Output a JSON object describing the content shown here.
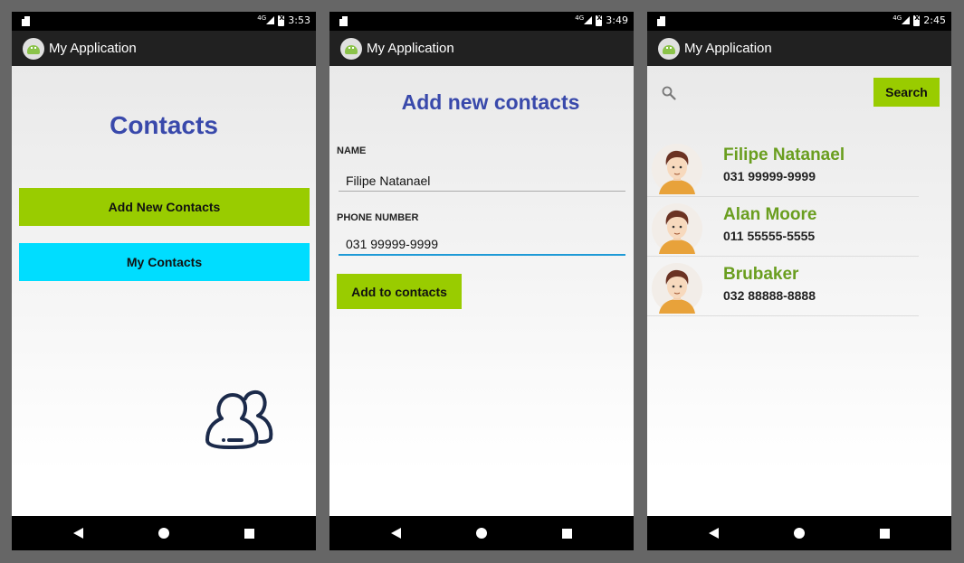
{
  "app": {
    "title": "My Application"
  },
  "screens": [
    {
      "status": {
        "network": "4G",
        "time": "3:53"
      },
      "title": "Contacts",
      "buttons": {
        "add_new": "Add New Contacts",
        "my_contacts": "My Contacts"
      },
      "illustration": "contacts-group-icon"
    },
    {
      "status": {
        "network": "4G",
        "time": "3:49"
      },
      "title": "Add new contacts",
      "form": {
        "name_label": "NAME",
        "name_value": "Filipe Natanael",
        "phone_label": "PHONE NUMBER",
        "phone_value": "031 99999-9999",
        "submit_label": "Add to contacts"
      }
    },
    {
      "status": {
        "network": "4G",
        "time": "2:45"
      },
      "search": {
        "button_label": "Search",
        "icon": "search-icon"
      },
      "contacts": [
        {
          "name": "Filipe Natanael",
          "phone": "031 99999-9999"
        },
        {
          "name": "Alan Moore",
          "phone": "011 55555-5555"
        },
        {
          "name": "Brubaker",
          "phone": "032 88888-8888"
        }
      ]
    }
  ],
  "colors": {
    "title_blue": "#3949ab",
    "accent_green": "#99cc00",
    "accent_cyan": "#00ddff",
    "contact_name_green": "#6a9e1f",
    "app_bar": "#212121"
  }
}
